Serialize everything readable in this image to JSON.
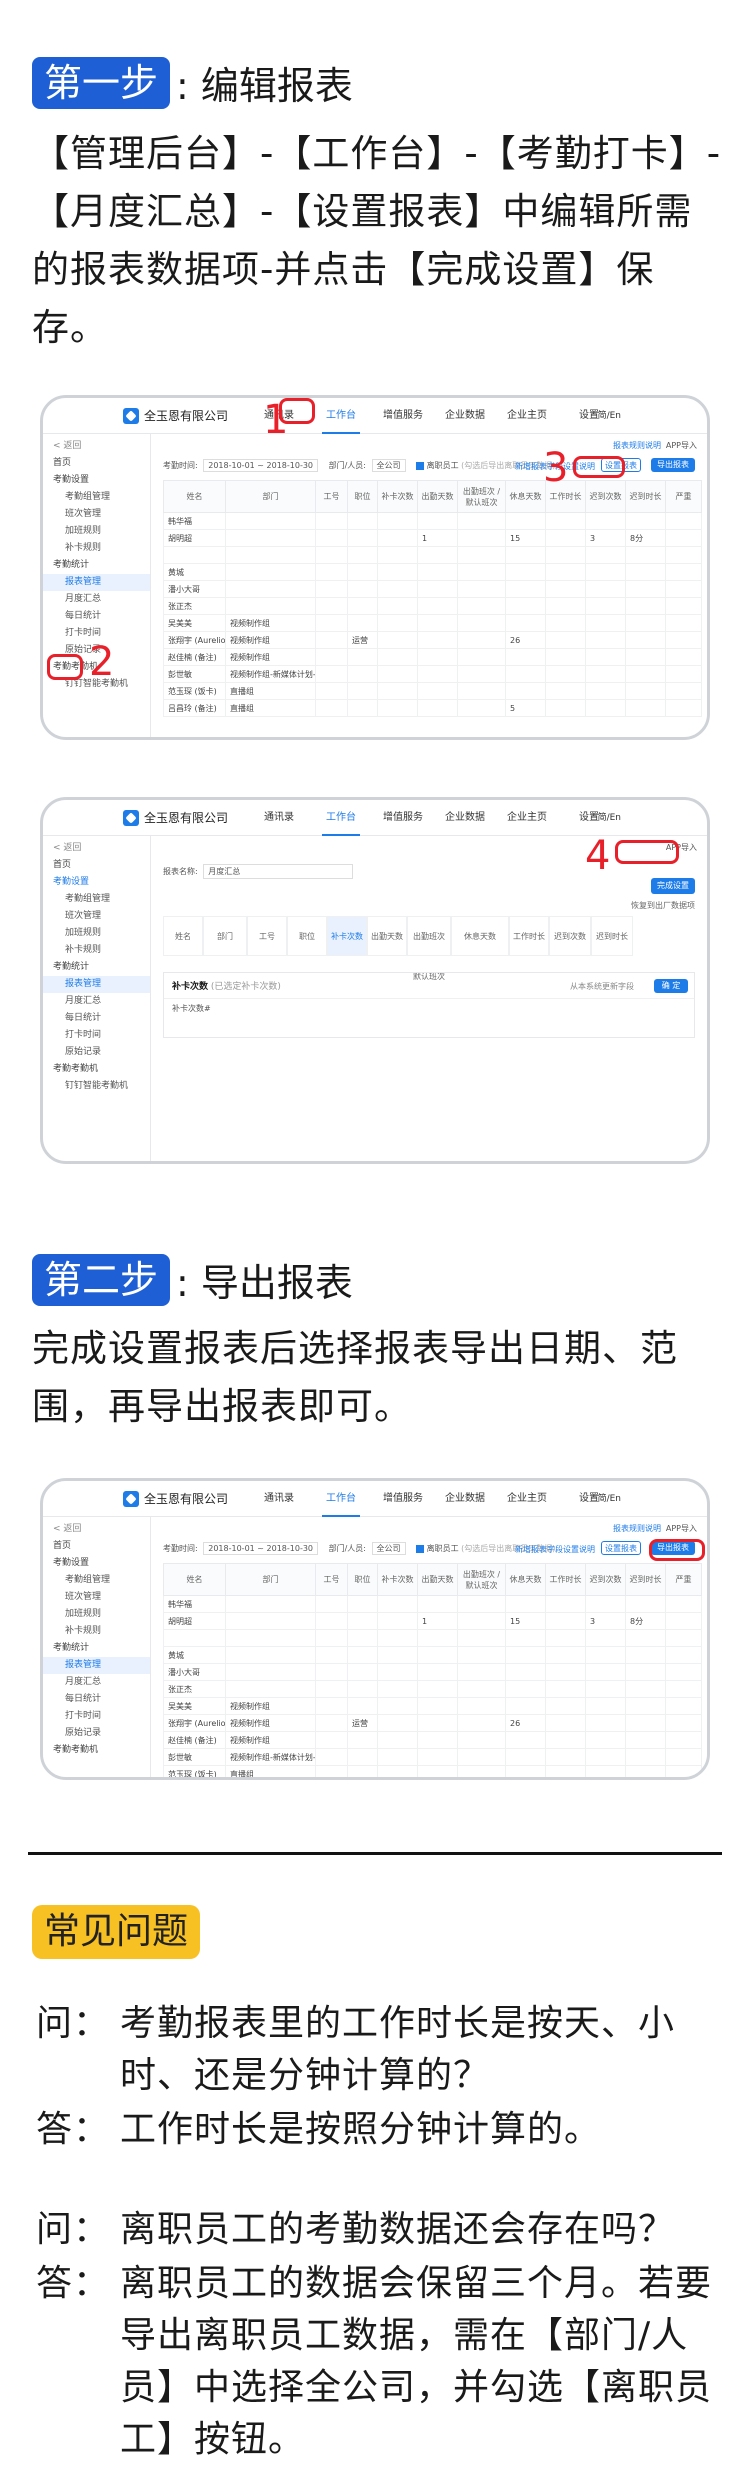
{
  "step1": {
    "badge": "第一步",
    "title": ": 编辑报表",
    "para": "【管理后台】-【工作台】-【考勤打卡】-【月度汇总】-【设置报表】中编辑所需的报表数据项-并点击【完成设置】保存。"
  },
  "step2": {
    "badge": "第二步",
    "title": ": 导出报表",
    "para": "完成设置报表后选择报表导出日期、范围，再导出报表即可。"
  },
  "app": {
    "company": "全玉恩有限公司",
    "nav": [
      "通讯录",
      "工作台",
      "增值服务",
      "企业数据",
      "企业主页",
      "设置"
    ],
    "lang": "简/En",
    "sidebar": [
      {
        "label": "< 返回",
        "kind": "back"
      },
      {
        "label": "首页",
        "kind": "top"
      },
      {
        "label": "考勤设置",
        "kind": "top"
      },
      {
        "label": "考勤组管理",
        "kind": "sub"
      },
      {
        "label": "班次管理",
        "kind": "sub"
      },
      {
        "label": "加班规则",
        "kind": "sub"
      },
      {
        "label": "补卡规则",
        "kind": "sub"
      },
      {
        "label": "考勤统计",
        "kind": "top"
      },
      {
        "label": "报表管理",
        "kind": "sub"
      },
      {
        "label": "月度汇总",
        "kind": "sub"
      },
      {
        "label": "每日统计",
        "kind": "sub"
      },
      {
        "label": "打卡时间",
        "kind": "sub"
      },
      {
        "label": "原始记录",
        "kind": "sub"
      },
      {
        "label": "考勤考勤机",
        "kind": "top"
      },
      {
        "label": "钉钉智能考勤机",
        "kind": "sub"
      }
    ],
    "filter": {
      "date_label": "考勤时间:",
      "date_value": "2018-10-01 ~ 2018-10-30",
      "dept_label": "部门/人员:",
      "dept_value": "全公司",
      "resigned": "离职员工",
      "resigned_hint": "(勾选后导出离职员工数据)"
    },
    "links": {
      "rule_desc": "报表规则说明",
      "import": "APP导入",
      "new_report": "新增报表字段设置说明",
      "set_report": "设置报表",
      "export_report": "导出报表",
      "done": "完成设置",
      "report_name_label": "报表名称:",
      "report_name": "月度汇总",
      "restore": "恢复到出厂数据项",
      "supplement_title": "补卡次数",
      "supplement_hint": "(已选定补卡次数)",
      "supplement_note": "补卡次数#",
      "supplement_btn": "确 定",
      "supplement_link": "从本系统更新字段"
    },
    "table_headers": [
      "姓名",
      "部门",
      "工号",
      "职位",
      "补卡次数",
      "出勤天数",
      "出勤班次 / 默认班次",
      "休息天数",
      "工作时长",
      "迟到次数",
      "迟到时长",
      "严重"
    ],
    "rows": [
      [
        "韩华福",
        "",
        "",
        "",
        "",
        "",
        "",
        "",
        "",
        "",
        "",
        ""
      ],
      [
        "胡明超",
        "",
        "",
        "",
        "",
        "1",
        "",
        "15",
        "",
        "3",
        "8分",
        ""
      ],
      [
        "",
        "",
        "",
        "",
        "",
        "",
        "",
        "",
        "",
        "",
        "",
        ""
      ],
      [
        "黄城",
        "",
        "",
        "",
        "",
        "",
        "",
        "",
        "",
        "",
        "",
        ""
      ],
      [
        "潘小大哥",
        "",
        "",
        "",
        "",
        "",
        "",
        "",
        "",
        "",
        "",
        ""
      ],
      [
        "张正杰",
        "",
        "",
        "",
        "",
        "",
        "",
        "",
        "",
        "",
        "",
        ""
      ],
      [
        "吴美美",
        "视频制作组",
        "",
        "",
        "",
        "",
        "",
        "",
        "",
        "",
        "",
        ""
      ],
      [
        "张翔宇 (Aurelio)",
        "视频制作组",
        "",
        "运营",
        "",
        "",
        "",
        "26",
        "",
        "",
        "",
        ""
      ],
      [
        "赵佳楠 (备注)",
        "视频制作组",
        "",
        "",
        "",
        "",
        "",
        "",
        "",
        "",
        "",
        ""
      ],
      [
        "彭世敏",
        "视频制作组-新媒体计划-影视组",
        "",
        "",
        "",
        "",
        "",
        "",
        "",
        "",
        "",
        ""
      ],
      [
        "范玉琛 (饭卡)",
        "直播组",
        "",
        "",
        "",
        "",
        "",
        "",
        "",
        "",
        "",
        ""
      ],
      [
        "吕昌玲 (备注)",
        "直播组",
        "",
        "",
        "",
        "",
        "",
        "5",
        "",
        "",
        "",
        ""
      ]
    ],
    "setting_cols": [
      "姓名",
      "部门",
      "工号",
      "职位",
      "补卡次数",
      "出勤天数",
      "出勤班次 默认班次",
      "休息天数",
      "工作时长",
      "迟到次数",
      "迟到时长"
    ]
  },
  "annotations": {
    "n1": "1",
    "n2": "2",
    "n3": "3",
    "n4": "4"
  },
  "faq": {
    "badge": "常见问题",
    "items": [
      {
        "q_key": "问：",
        "q": "考勤报表里的工作时长是按天、小时、还是分钟计算的？",
        "a_key": "答：",
        "a": "工作时长是按照分钟计算的。"
      },
      {
        "q_key": "问：",
        "q": "离职员工的考勤数据还会存在吗？",
        "a_key": "答：",
        "a": "离职员工的数据会保留三个月。若要导出离职员工数据，需在【部门/人员】中选择全公司，并勾选【离职员工】按钮。"
      }
    ]
  },
  "colors": {
    "step_badge": "#1f5fd6",
    "faq_badge": "#f7c023",
    "accent": "#1e7ce8",
    "annotation": "#e8202a"
  }
}
